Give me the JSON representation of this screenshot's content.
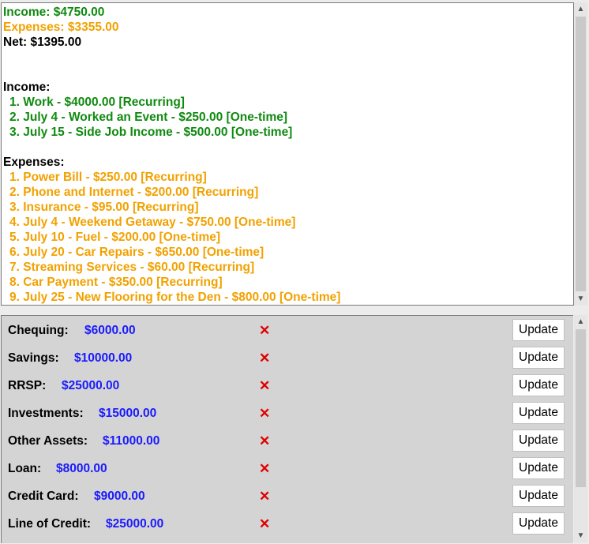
{
  "colors": {
    "income": "#0f8a0f",
    "expense": "#f2a100",
    "value": "#1a1aff",
    "delete": "#e00000"
  },
  "summary": {
    "income_total": "Income: $4750.00",
    "expenses_total": "Expenses: $3355.00",
    "net_total": "Net: $1395.00",
    "income_heading": "Income:",
    "income_items": [
      "1. Work - $4000.00 [Recurring]",
      "2. July 4 - Worked an Event - $250.00 [One-time]",
      "3. July 15 - Side Job Income - $500.00 [One-time]"
    ],
    "expenses_heading": "Expenses:",
    "expense_items": [
      "1. Power Bill - $250.00 [Recurring]",
      "2. Phone and Internet - $200.00 [Recurring]",
      "3. Insurance - $95.00 [Recurring]",
      "4. July 4 - Weekend Getaway - $750.00 [One-time]",
      "5. July 10 - Fuel - $200.00 [One-time]",
      "6. July 20 - Car Repairs - $650.00 [One-time]",
      "7. Streaming Services - $60.00 [Recurring]",
      "8. Car Payment - $350.00 [Recurring]",
      "9. July 25 - New Flooring for the Den - $800.00 [One-time]"
    ]
  },
  "accounts": [
    {
      "label": "Chequing:",
      "value": "$6000.00",
      "delete": "✕",
      "update": "Update"
    },
    {
      "label": "Savings:",
      "value": "$10000.00",
      "delete": "✕",
      "update": "Update"
    },
    {
      "label": "RRSP:",
      "value": "$25000.00",
      "delete": "✕",
      "update": "Update"
    },
    {
      "label": "Investments:",
      "value": "$15000.00",
      "delete": "✕",
      "update": "Update"
    },
    {
      "label": "Other Assets:",
      "value": "$11000.00",
      "delete": "✕",
      "update": "Update"
    },
    {
      "label": "Loan:",
      "value": "$8000.00",
      "delete": "✕",
      "update": "Update"
    },
    {
      "label": "Credit Card:",
      "value": "$9000.00",
      "delete": "✕",
      "update": "Update"
    },
    {
      "label": "Line of Credit:",
      "value": "$25000.00",
      "delete": "✕",
      "update": "Update"
    }
  ],
  "scrollbar_icons": {
    "up": "up-arrow-icon",
    "down": "down-arrow-icon"
  }
}
